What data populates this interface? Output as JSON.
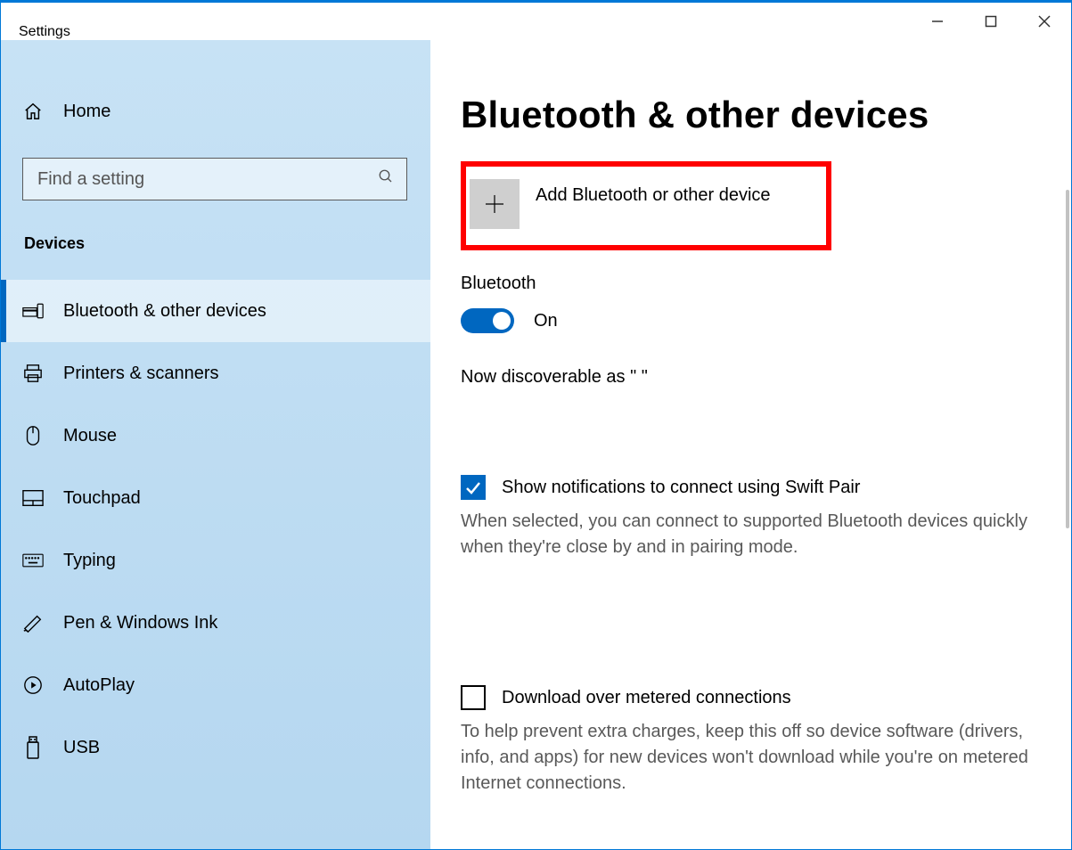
{
  "window": {
    "title": "Settings"
  },
  "sidebar": {
    "home_label": "Home",
    "search_placeholder": "Find a setting",
    "section_title": "Devices",
    "items": [
      {
        "label": "Bluetooth & other devices",
        "icon": "devices-icon",
        "active": true
      },
      {
        "label": "Printers & scanners",
        "icon": "printer-icon"
      },
      {
        "label": "Mouse",
        "icon": "mouse-icon"
      },
      {
        "label": "Touchpad",
        "icon": "touchpad-icon"
      },
      {
        "label": "Typing",
        "icon": "keyboard-icon"
      },
      {
        "label": "Pen & Windows Ink",
        "icon": "pen-icon"
      },
      {
        "label": "AutoPlay",
        "icon": "autoplay-icon"
      },
      {
        "label": "USB",
        "icon": "usb-icon"
      }
    ]
  },
  "main": {
    "page_title": "Bluetooth & other devices",
    "add_device_label": "Add Bluetooth or other device",
    "bluetooth_section_label": "Bluetooth",
    "bluetooth_state_label": "On",
    "discoverable_text": "Now discoverable as \"                               \"",
    "swift_pair_label": "Show notifications to connect using Swift Pair",
    "swift_pair_desc": "When selected, you can connect to supported Bluetooth devices quickly when they're close by and in pairing mode.",
    "metered_label": "Download over metered connections",
    "metered_desc": "To help prevent extra charges, keep this off so device software (drivers, info, and apps) for new devices won't download while you're on metered Internet connections."
  }
}
